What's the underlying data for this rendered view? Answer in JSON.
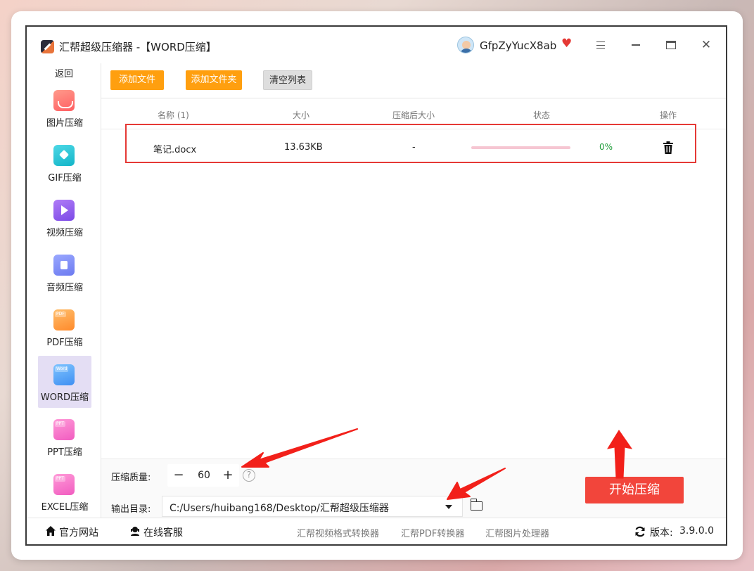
{
  "window": {
    "title": "汇帮超级压缩器 -【WORD压缩】",
    "username": "GfpZyYucX8ab"
  },
  "sidebar": {
    "back": "返回",
    "items": [
      {
        "label": "图片压缩",
        "icon": "image-icon"
      },
      {
        "label": "GIF压缩",
        "icon": "gif-icon"
      },
      {
        "label": "视频压缩",
        "icon": "video-icon"
      },
      {
        "label": "音频压缩",
        "icon": "audio-icon"
      },
      {
        "label": "PDF压缩",
        "icon": "pdf-icon",
        "tag": "PDF"
      },
      {
        "label": "WORD压缩",
        "icon": "word-icon",
        "tag": "Word",
        "active": true
      },
      {
        "label": "PPT压缩",
        "icon": "ppt-icon",
        "tag": "PPT"
      },
      {
        "label": "EXCEL压缩",
        "icon": "excel-icon",
        "tag": "PPT"
      }
    ]
  },
  "toolbar": {
    "add_file": "添加文件",
    "add_folder": "添加文件夹",
    "clear_list": "清空列表"
  },
  "table": {
    "headers": [
      "名称 (1)",
      "大小",
      "压缩后大小",
      "状态",
      "操作"
    ],
    "rows": [
      {
        "name": "笔记.docx",
        "size": "13.63KB",
        "compressed_size": "-",
        "progress": 0,
        "status": "0%"
      }
    ]
  },
  "settings": {
    "quality_label": "压缩质量:",
    "quality_value": "60",
    "minus": "−",
    "plus": "+",
    "help": "?",
    "output_label": "输出目录:",
    "output_path": "C:/Users/huibang168/Desktop/汇帮超级压缩器",
    "start": "开始压缩"
  },
  "footer": {
    "website": "官方网站",
    "support": "在线客服",
    "links": [
      "汇帮视频格式转换器",
      "汇帮PDF转换器",
      "汇帮图片处理器"
    ],
    "version_label": "版本:",
    "version": "3.9.0.0"
  },
  "colors": {
    "accent_orange": "#ff9f0f",
    "start_red": "#f2453b",
    "highlight_red": "#e53935",
    "status_green": "#1f9d3a",
    "active_bg": "#e4def4"
  }
}
